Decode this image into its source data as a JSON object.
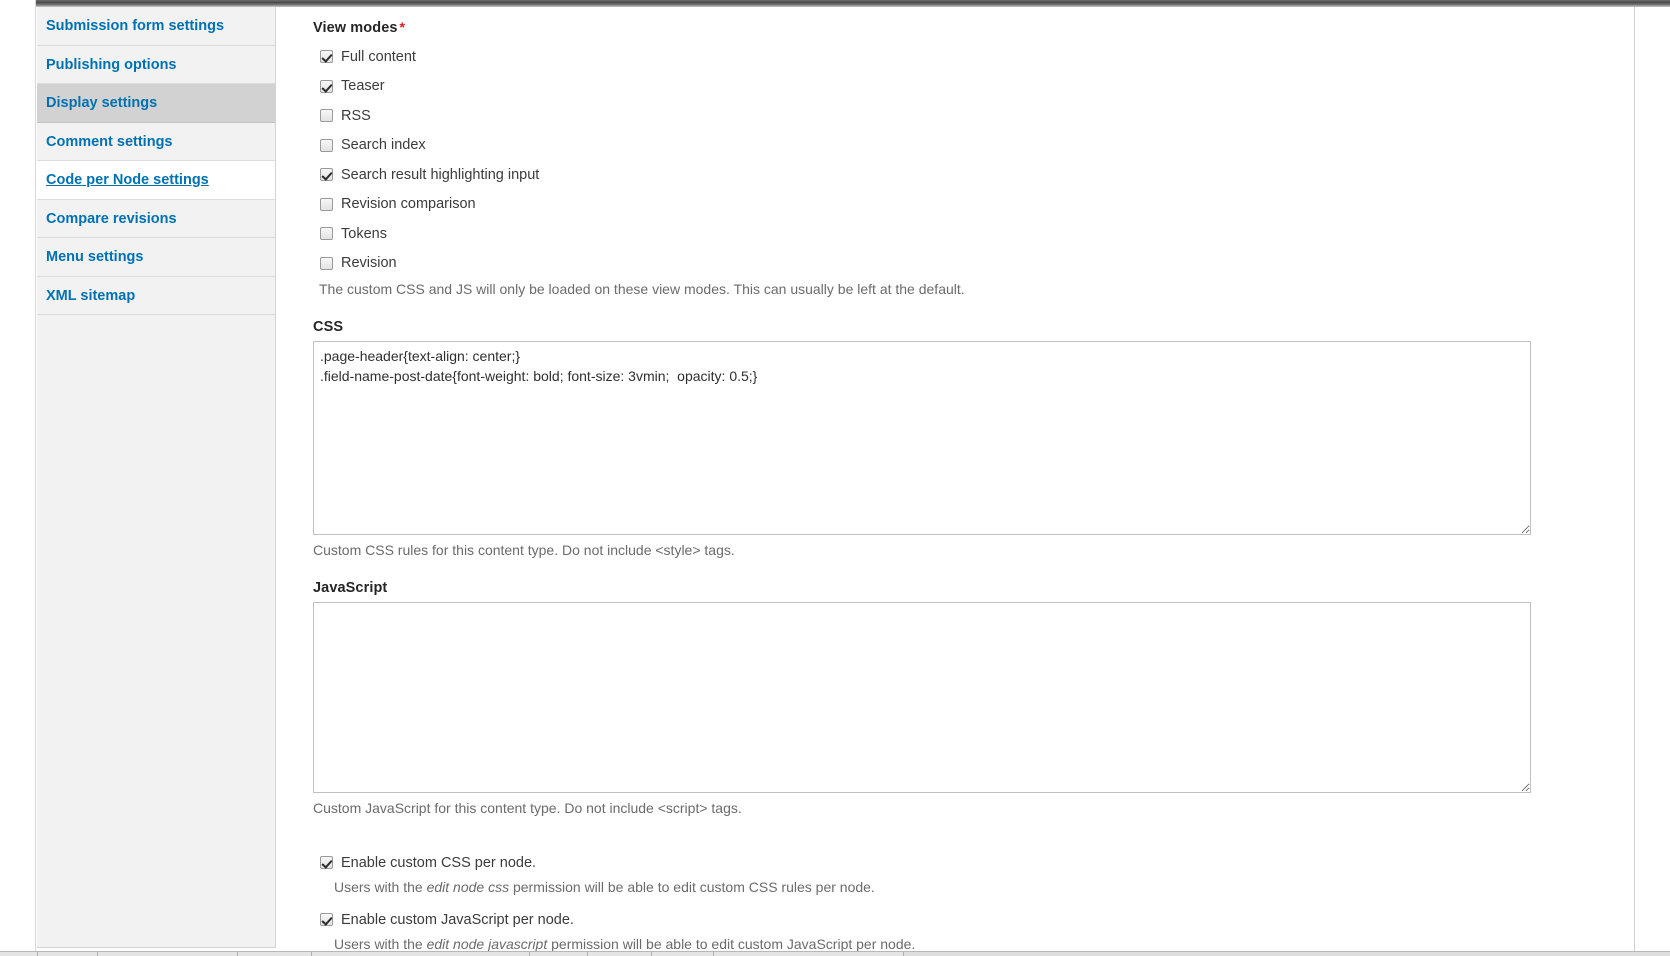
{
  "sidebar": {
    "items": [
      {
        "label": "Submission form settings",
        "state": "normal"
      },
      {
        "label": "Publishing options",
        "state": "normal"
      },
      {
        "label": "Display settings",
        "state": "selected"
      },
      {
        "label": "Comment settings",
        "state": "normal"
      },
      {
        "label": "Code per Node settings",
        "state": "active-link"
      },
      {
        "label": "Compare revisions",
        "state": "normal"
      },
      {
        "label": "Menu settings",
        "state": "normal"
      },
      {
        "label": "XML sitemap",
        "state": "normal"
      }
    ]
  },
  "view_modes": {
    "label": "View modes",
    "required_marker": "*",
    "options": [
      {
        "label": "Full content",
        "checked": true
      },
      {
        "label": "Teaser",
        "checked": true
      },
      {
        "label": "RSS",
        "checked": false
      },
      {
        "label": "Search index",
        "checked": false
      },
      {
        "label": "Search result highlighting input",
        "checked": true
      },
      {
        "label": "Revision comparison",
        "checked": false
      },
      {
        "label": "Tokens",
        "checked": false
      },
      {
        "label": "Revision",
        "checked": false
      }
    ],
    "description": "The custom CSS and JS will only be loaded on these view modes. This can usually be left at the default."
  },
  "css_field": {
    "label": "CSS",
    "value": ".page-header{text-align: center;}\n.field-name-post-date{font-weight: bold; font-size: 3vmin;  opacity: 0.5;}",
    "placeholder": "",
    "description": "Custom CSS rules for this content type. Do not include <style> tags."
  },
  "js_field": {
    "label": "JavaScript",
    "value": "",
    "placeholder": "",
    "description": "Custom JavaScript for this content type. Do not include <script> tags."
  },
  "enable_css": {
    "label": "Enable custom CSS per node.",
    "checked": true,
    "description_prefix": "Users with the ",
    "description_em": "edit node css",
    "description_suffix": " permission will be able to edit custom CSS rules per node."
  },
  "enable_js": {
    "label": "Enable custom JavaScript per node.",
    "checked": true,
    "description_prefix": "Users with the ",
    "description_em": "edit node javascript",
    "description_suffix": " permission will be able to edit custom JavaScript per node."
  },
  "colors": {
    "link": "#0071b3",
    "selected_tab_bg": "#d2d2d2",
    "sidebar_bg": "#f2f2f2",
    "required": "#e51919",
    "help_text": "#6b6b6b"
  }
}
